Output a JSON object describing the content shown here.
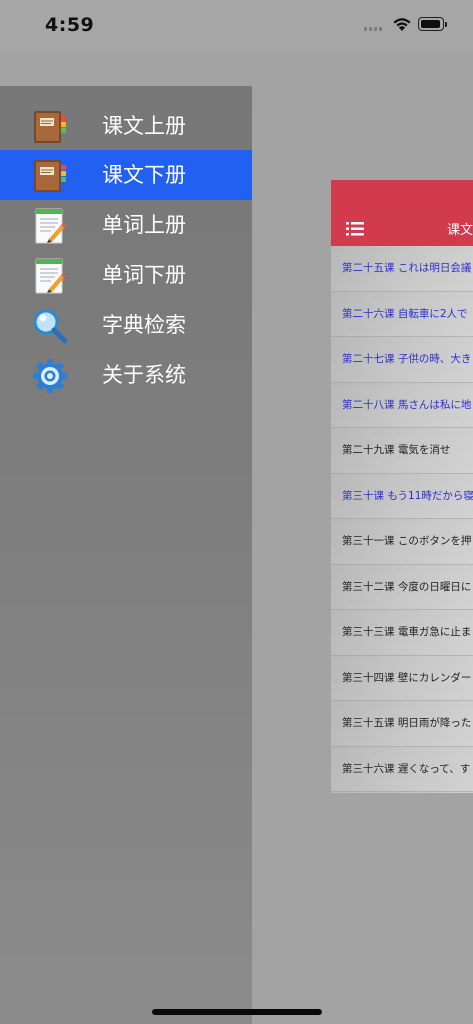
{
  "status_bar": {
    "time": "4:59"
  },
  "side_menu": {
    "items": [
      {
        "label": "课文上册",
        "icon": "notebook-icon",
        "active": false
      },
      {
        "label": "课文下册",
        "icon": "notebook-icon",
        "active": true
      },
      {
        "label": "单词上册",
        "icon": "pencil-note-icon",
        "active": false
      },
      {
        "label": "单词下册",
        "icon": "pencil-note-icon",
        "active": false
      },
      {
        "label": "字典检索",
        "icon": "magnifier-icon",
        "active": false
      },
      {
        "label": "关于系统",
        "icon": "gear-icon",
        "active": false
      }
    ]
  },
  "content": {
    "title": "课文",
    "menu_icon": "list-menu-icon",
    "lessons": [
      {
        "text": "第二十五课 これは明日会議",
        "color": "#2a2fcf"
      },
      {
        "text": "第二十六课 自転車に2人で",
        "color": "#2a2fcf"
      },
      {
        "text": "第二十七课 子供の時、大き",
        "color": "#2a2fcf"
      },
      {
        "text": "第二十八课 馬さんは私に地",
        "color": "#2a2fcf"
      },
      {
        "text": "第二十九课 電気を消せ",
        "color": "#222222"
      },
      {
        "text": "第三十课 もう11時だから寝",
        "color": "#2a2fcf"
      },
      {
        "text": "第三十一课 このボタンを押",
        "color": "#222222"
      },
      {
        "text": "第三十二课 今度の日曜日に りです",
        "color": "#222222"
      },
      {
        "text": "第三十三课 電車ガ急に止ま",
        "color": "#222222"
      },
      {
        "text": "第三十四课 壁にカレンダー",
        "color": "#222222"
      },
      {
        "text": "第三十五课 明日雨が降った 止です",
        "color": "#222222"
      },
      {
        "text": "第三十六课 遅くなって、す",
        "color": "#222222"
      }
    ]
  }
}
